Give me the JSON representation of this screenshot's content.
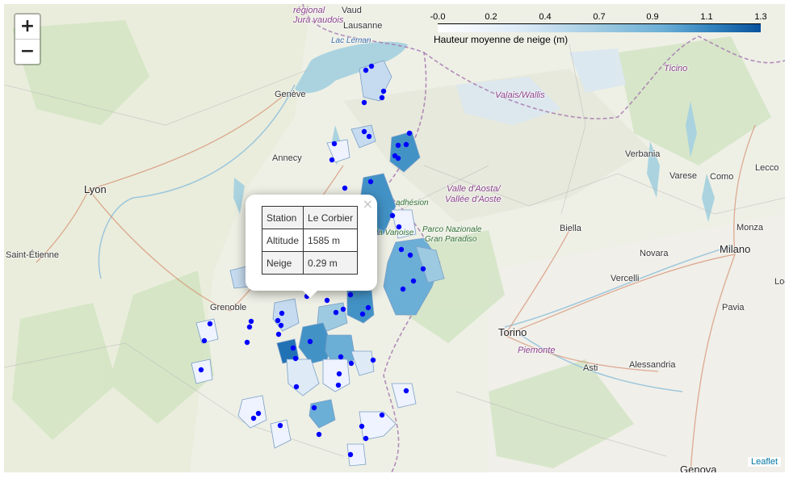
{
  "zoom": {
    "in_label": "+",
    "out_label": "−"
  },
  "legend": {
    "ticks": [
      "-0.0",
      "0.2",
      "0.4",
      "0.7",
      "0.9",
      "1.1",
      "1.3"
    ],
    "caption": "Hauteur moyenne de neige (m)",
    "colors": [
      "#ffffff",
      "#deebf7",
      "#9ecae1",
      "#6baed6",
      "#3182bd",
      "#08519c"
    ]
  },
  "popup": {
    "close": "×",
    "rows": [
      {
        "key": "Station",
        "value": "Le Corbier"
      },
      {
        "key": "Altitude",
        "value": "1585 m"
      },
      {
        "key": "Neige",
        "value": "0.29 m"
      }
    ]
  },
  "labels": {
    "lausanne": "Lausanne",
    "vaud": "Vaud",
    "jura": "régional\nJura vaudois",
    "lac_leman": "Lac Léman",
    "geneve": "Genève",
    "valais": "Valais/Wallis",
    "ticino": "Ticino",
    "annecy": "Annecy",
    "lyon": "Lyon",
    "saint_etienne": "Saint-Étienne",
    "grenoble": "Grenoble",
    "verbania": "Verbania",
    "varese": "Varese",
    "como": "Como",
    "lecco": "Lecco",
    "valle_aosta": "Valle d'Aosta/",
    "vallee_aoste": "Vallée d'Aoste",
    "parco": "Parco Nazionale",
    "gran_paradiso": "Gran Paradiso",
    "biella": "Biella",
    "monza": "Monza",
    "milano": "Milano",
    "novara": "Novara",
    "vercelli": "Vercelli",
    "lodi": "Lodi",
    "pavia": "Pavia",
    "torino": "Torino",
    "piemonte": "Piemonte",
    "asti": "Asti",
    "alessandria": "Alessandria",
    "genova": "Genova",
    "adhesion": "adhésion",
    "vanoise": "la Vanoise"
  },
  "attribution": "Leaflet"
}
